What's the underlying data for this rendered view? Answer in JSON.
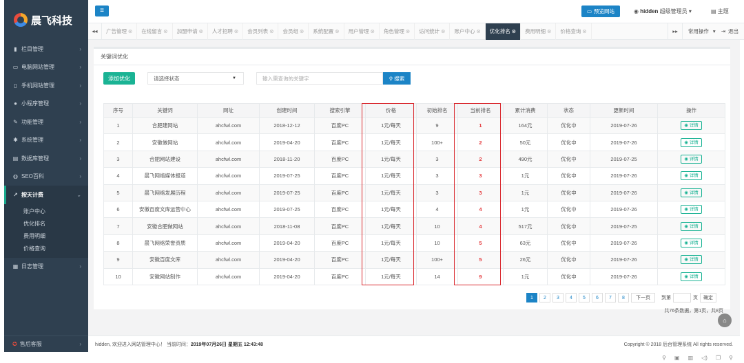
{
  "sidebar": {
    "logo_text": "晨飞科技",
    "menu": [
      {
        "label": "栏目管理",
        "icon": "list-icon"
      },
      {
        "label": "电脑网站管理",
        "icon": "monitor-icon"
      },
      {
        "label": "手机网站管理",
        "icon": "mobile-icon"
      },
      {
        "label": "小程序管理",
        "icon": "chat-icon"
      },
      {
        "label": "功能管理",
        "icon": "wrench-icon"
      },
      {
        "label": "系统管理",
        "icon": "gear-icon"
      },
      {
        "label": "数据库管理",
        "icon": "database-icon"
      },
      {
        "label": "SEO百科",
        "icon": "globe-icon"
      }
    ],
    "active_menu": {
      "label": "按天计费",
      "icon": "chart-icon"
    },
    "submenu": [
      "账户中心",
      "优化排名",
      "费用明细",
      "价格查询"
    ],
    "after_menu": {
      "label": "日志管理",
      "icon": "log-icon"
    },
    "bottom": {
      "label": "售后客服",
      "icon": "support-icon"
    }
  },
  "header": {
    "preview_label": "预览网站",
    "user_name": "hidden",
    "user_role": "超级管理员",
    "theme_label": "主题"
  },
  "tabs": {
    "items": [
      "广告管理",
      "在线留言",
      "加盟申请",
      "人才招聘",
      "会员列表",
      "会员组",
      "系统配置",
      "用户管理",
      "角色管理",
      "访问统计",
      "账户中心",
      "优化排名",
      "费用明细",
      "价格查询"
    ],
    "active_index": 11,
    "common_ops": "常用操作",
    "logout": "退出"
  },
  "panel": {
    "title": "关键词优化",
    "add_label": "添加优化",
    "status_select": "请选择状态",
    "keyword_placeholder": "输入需查询的关键字",
    "search_label": "搜索"
  },
  "table": {
    "headers": [
      "序号",
      "关键词",
      "网址",
      "创建时间",
      "搜索引擎",
      "价格",
      "初始排名",
      "当前排名",
      "累计消费",
      "状态",
      "更新时间",
      "操作"
    ],
    "rows": [
      [
        "1",
        "合肥建网站",
        "ahcfwl.com",
        "2018-12-12",
        "百度PC",
        "1元/每天",
        "9",
        "1",
        "164元",
        "优化中",
        "2019-07-26"
      ],
      [
        "2",
        "安徽做网站",
        "ahcfwl.com",
        "2019-04-20",
        "百度PC",
        "1元/每天",
        "100+",
        "2",
        "50元",
        "优化中",
        "2019-07-26"
      ],
      [
        "3",
        "合肥网站建设",
        "ahcfwl.com",
        "2018-11-20",
        "百度PC",
        "1元/每天",
        "3",
        "2",
        "490元",
        "优化中",
        "2019-07-25"
      ],
      [
        "4",
        "晨飞网络媒体报道",
        "ahcfwl.com",
        "2019-07-25",
        "百度PC",
        "1元/每天",
        "3",
        "3",
        "1元",
        "优化中",
        "2019-07-26"
      ],
      [
        "5",
        "晨飞网络发展历程",
        "ahcfwl.com",
        "2019-07-25",
        "百度PC",
        "1元/每天",
        "3",
        "3",
        "1元",
        "优化中",
        "2019-07-26"
      ],
      [
        "6",
        "安徽百度文库运营中心",
        "ahcfwl.com",
        "2019-07-25",
        "百度PC",
        "1元/每天",
        "4",
        "4",
        "1元",
        "优化中",
        "2019-07-26"
      ],
      [
        "7",
        "安徽合肥做网站",
        "ahcfwl.com",
        "2018-11-08",
        "百度PC",
        "1元/每天",
        "10",
        "4",
        "517元",
        "优化中",
        "2019-07-25"
      ],
      [
        "8",
        "晨飞网络荣誉资质",
        "ahcfwl.com",
        "2019-04-20",
        "百度PC",
        "1元/每天",
        "10",
        "5",
        "63元",
        "优化中",
        "2019-07-26"
      ],
      [
        "9",
        "安徽百度文库",
        "ahcfwl.com",
        "2019-04-20",
        "百度PC",
        "1元/每天",
        "100+",
        "5",
        "26元",
        "优化中",
        "2019-07-26"
      ],
      [
        "10",
        "安徽网站制作",
        "ahcfwl.com",
        "2019-04-20",
        "百度PC",
        "1元/每天",
        "14",
        "9",
        "1元",
        "优化中",
        "2019-07-26"
      ]
    ],
    "detail_label": "详情"
  },
  "pagination": {
    "pages": [
      "1",
      "2",
      "3",
      "4",
      "5",
      "6",
      "7",
      "8"
    ],
    "current": "1",
    "next_label": "下一页",
    "jump_label": "到第",
    "page_unit": "页",
    "confirm_label": "确定",
    "summary": "共76条数据，第1页，共8页"
  },
  "footer": {
    "welcome": "hidden, 欢迎进入网站管理中心！ 当前时间：",
    "datetime": "2019年07月26日 星期五 12:43:48",
    "copyright": "Copyright © 2018 后台管理系统 All rights reserved."
  },
  "colors": {
    "sidebar_bg": "#2f4050",
    "primary": "#1c84c6",
    "success": "#1ab394",
    "rank_red": "#e4393c",
    "highlight_red": "#d9262c"
  }
}
